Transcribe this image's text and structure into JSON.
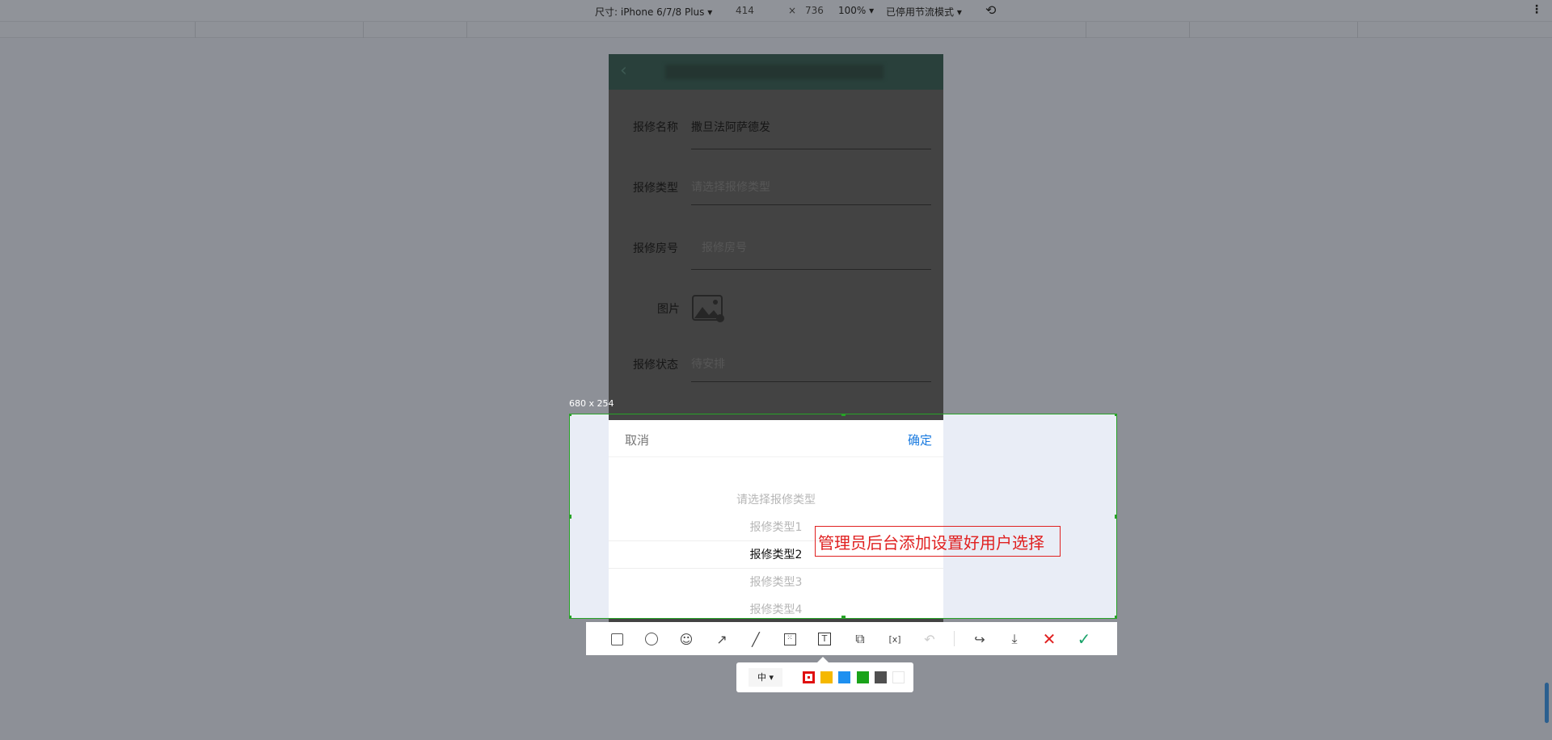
{
  "devtools": {
    "device_label": "尺寸: iPhone 6/7/8 Plus ▾",
    "width": "414",
    "times": "×",
    "height": "736",
    "zoom": "100% ▾",
    "throttle": "已停用节流模式 ▾",
    "rotate_icon": "rotate-icon",
    "more_icon": "⋮"
  },
  "form": {
    "back_icon": "‹",
    "rows": [
      {
        "label": "报修名称",
        "value": "撒旦法阿萨德发"
      },
      {
        "label": "报修类型",
        "placeholder": "请选择报修类型"
      },
      {
        "label": "报修房号",
        "placeholder": "报修房号"
      },
      {
        "label": "图片"
      },
      {
        "label": "报修状态",
        "placeholder": "待安排"
      }
    ]
  },
  "capture": {
    "size_label": "680 x 254",
    "annotation": "管理员后台添加设置好用户选择",
    "annotation_color": "#e02020"
  },
  "picker": {
    "cancel": "取消",
    "confirm": "确定",
    "confirm_color": "#1a7be0",
    "options": [
      "请选择报修类型",
      "报修类型1",
      "报修类型2",
      "报修类型3",
      "报修类型4"
    ],
    "selected_index": 2
  },
  "toolbar": {
    "tools": [
      "rectangle-icon",
      "ellipse-icon",
      "emoji-icon",
      "arrow-icon",
      "pen-icon",
      "mosaic-icon",
      "text-icon",
      "pin-icon",
      "ocr-icon",
      "undo-icon",
      "share-icon",
      "download-icon",
      "cancel-icon",
      "confirm-icon"
    ]
  },
  "style_bar": {
    "size": "中 ▾",
    "colors": [
      "#e01010",
      "#f5b800",
      "#1e90f0",
      "#1aa31a",
      "#505050",
      "#ffffff"
    ],
    "selected_color": "#e01010"
  }
}
